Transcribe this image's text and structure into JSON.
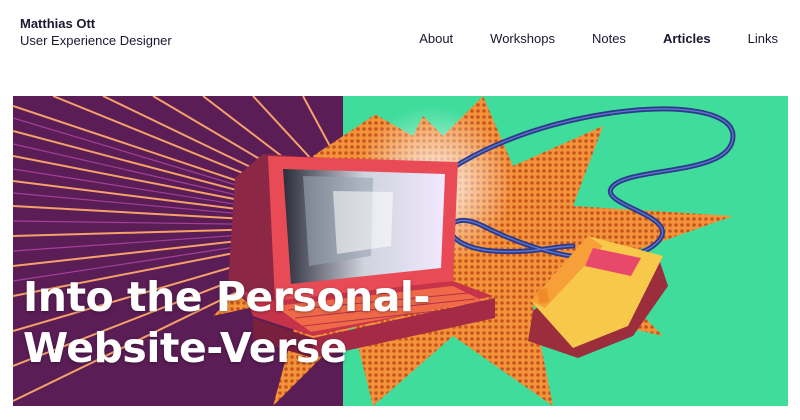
{
  "site": {
    "name": "Matthias Ott",
    "role": "User Experience Designer"
  },
  "nav": {
    "items": [
      {
        "label": "About",
        "active": false
      },
      {
        "label": "Workshops",
        "active": false
      },
      {
        "label": "Notes",
        "active": false
      },
      {
        "label": "Articles",
        "active": true
      },
      {
        "label": "Links",
        "active": false
      }
    ]
  },
  "hero": {
    "title_line1": "Into the Personal-",
    "title_line2": "Website-Verse",
    "colors": {
      "background": "#3fdc9c",
      "rays": "#6a1f5a",
      "burst": "#f08a2a",
      "computer": "#e84b4b",
      "mouse": "#f7c84a",
      "cable": "#3b4fa8"
    }
  }
}
